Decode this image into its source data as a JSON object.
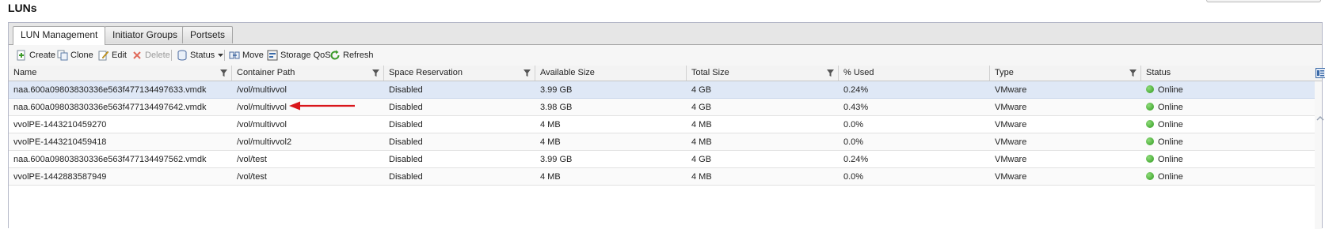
{
  "page": {
    "title": "LUNs"
  },
  "tabs": [
    {
      "label": "LUN Management",
      "active": true
    },
    {
      "label": "Initiator Groups",
      "active": false
    },
    {
      "label": "Portsets",
      "active": false
    }
  ],
  "toolbar": {
    "create": "Create",
    "clone": "Clone",
    "edit": "Edit",
    "delete": "Delete",
    "status": "Status",
    "move": "Move",
    "storage_qos": "Storage QoS",
    "refresh": "Refresh"
  },
  "columns": [
    "Name",
    "Container Path",
    "Space Reservation",
    "Available Size",
    "Total Size",
    "% Used",
    "Type",
    "Status"
  ],
  "rows": [
    {
      "name": "naa.600a09803830336e563f477134497633.vmdk",
      "path": "/vol/multivvol",
      "space": "Disabled",
      "avail": "3.99 GB",
      "total": "4 GB",
      "used": "0.24%",
      "type": "VMware",
      "status": "Online"
    },
    {
      "name": "naa.600a09803830336e563f477134497642.vmdk",
      "path": "/vol/multivvol",
      "space": "Disabled",
      "avail": "3.98 GB",
      "total": "4 GB",
      "used": "0.43%",
      "type": "VMware",
      "status": "Online"
    },
    {
      "name": "vvolPE-1443210459270",
      "path": "/vol/multivvol",
      "space": "Disabled",
      "avail": "4 MB",
      "total": "4 MB",
      "used": "0.0%",
      "type": "VMware",
      "status": "Online"
    },
    {
      "name": "vvolPE-1443210459418",
      "path": "/vol/multivvol2",
      "space": "Disabled",
      "avail": "4 MB",
      "total": "4 MB",
      "used": "0.0%",
      "type": "VMware",
      "status": "Online"
    },
    {
      "name": "naa.600a09803830336e563f477134497562.vmdk",
      "path": "/vol/test",
      "space": "Disabled",
      "avail": "3.99 GB",
      "total": "4 GB",
      "used": "0.24%",
      "type": "VMware",
      "status": "Online"
    },
    {
      "name": "vvolPE-1442883587949",
      "path": "/vol/test",
      "space": "Disabled",
      "avail": "4 MB",
      "total": "4 MB",
      "used": "0.0%",
      "type": "VMware",
      "status": "Online"
    }
  ],
  "colors": {
    "selected_row": "#dfe8f6",
    "online": "#3aa52a",
    "annotation_arrow": "#d9161b"
  }
}
